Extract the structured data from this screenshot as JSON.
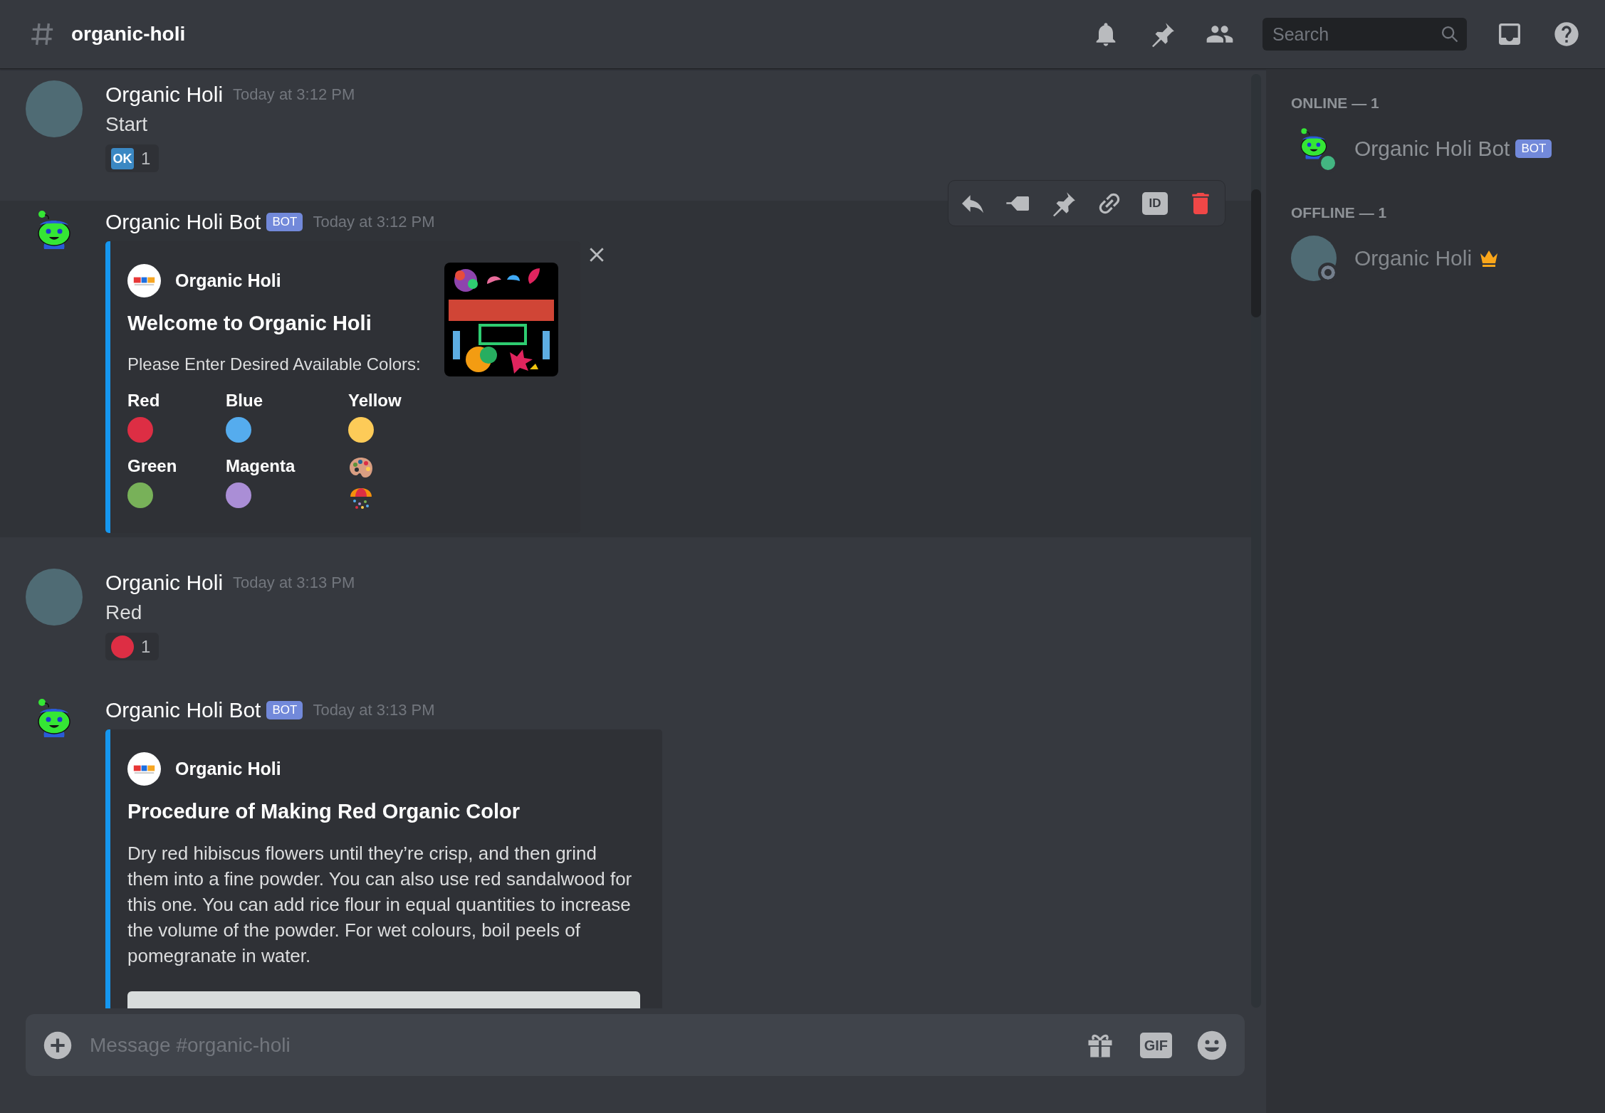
{
  "header": {
    "channel_name": "organic-holi",
    "search": {
      "placeholder": "Search"
    }
  },
  "messages": [
    {
      "kind": "user",
      "author": "Organic Holi",
      "timestamp": "Today at 3:12 PM",
      "text": "Start",
      "reactions": [
        {
          "kind": "ok",
          "label": "OK",
          "count": "1"
        }
      ]
    },
    {
      "kind": "bot",
      "author": "Organic Holi Bot",
      "tag": "BOT",
      "timestamp": "Today at 3:12 PM",
      "highlighted": true,
      "actions": [
        {
          "kind": "reply"
        },
        {
          "kind": "tag"
        },
        {
          "kind": "pin"
        },
        {
          "kind": "link"
        },
        {
          "kind": "id",
          "label": "ID"
        },
        {
          "kind": "delete"
        }
      ],
      "embed": {
        "author": "Organic Holi",
        "title": "Welcome to Organic Holi",
        "description": "Please Enter Desired Available Colors:",
        "thumbnail": true,
        "closable": true,
        "fields": [
          {
            "kind": "color",
            "name": "Red",
            "color": "#dd2e44"
          },
          {
            "kind": "color",
            "name": "Blue",
            "color": "#55acee"
          },
          {
            "kind": "color",
            "name": "Yellow",
            "color": "#fdcb58"
          },
          {
            "kind": "color",
            "name": "Green",
            "color": "#78b159"
          },
          {
            "kind": "color",
            "name": "Magenta",
            "color": "#aa8ed6"
          },
          {
            "kind": "emojis"
          }
        ]
      }
    },
    {
      "kind": "user",
      "author": "Organic Holi",
      "timestamp": "Today at 3:13 PM",
      "text": "Red",
      "reactions": [
        {
          "kind": "dot",
          "color": "#dd2e44",
          "count": "1"
        }
      ]
    },
    {
      "kind": "bot",
      "author": "Organic Holi Bot",
      "tag": "BOT",
      "timestamp": "Today at 3:13 PM",
      "highlighted": false,
      "embed": {
        "author": "Organic Holi",
        "title": "Procedure of Making Red Organic Color",
        "description": "Dry red hibiscus flowers until they’re crisp, and then grind them into a fine powder. You can also use red sandalwood for this one. You can add rice flour in equal quantities to increase the volume of the powder. For wet colours, boil peels of pomegranate in water.",
        "image": true
      }
    }
  ],
  "composer": {
    "placeholder": "Message #organic-holi",
    "gif_label": "GIF"
  },
  "members": [
    {
      "title": "ONLINE — 1",
      "members": [
        {
          "name": "Organic Holi Bot",
          "tag": "BOT",
          "kind": "bot",
          "online": true,
          "owner": false
        }
      ]
    },
    {
      "title": "OFFLINE — 1",
      "members": [
        {
          "name": "Organic Holi",
          "kind": "user",
          "online": false,
          "owner": true
        }
      ]
    }
  ]
}
